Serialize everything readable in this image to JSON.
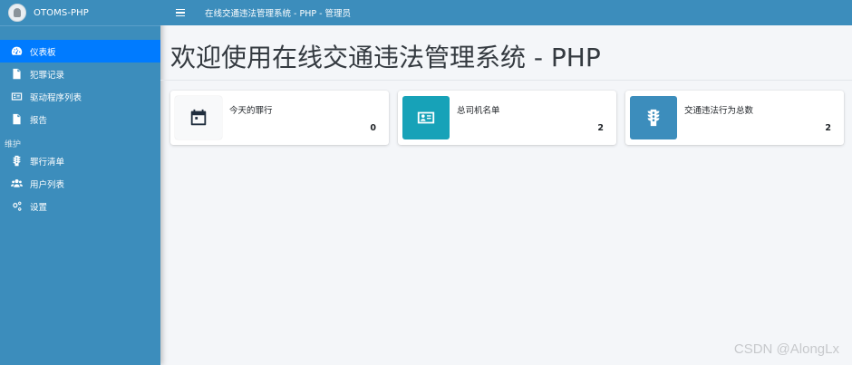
{
  "brand": {
    "name": "OTOMS-PHP"
  },
  "menu": {
    "items": [
      {
        "label": "仪表板",
        "icon": "dashboard-icon",
        "active": true
      },
      {
        "label": "犯罪记录",
        "icon": "file-icon"
      },
      {
        "label": "驱动程序列表",
        "icon": "id-card-icon"
      },
      {
        "label": "报告",
        "icon": "file-icon"
      }
    ],
    "section_header": "维护",
    "maintenance_items": [
      {
        "label": "罪行清单",
        "icon": "traffic-light-icon"
      },
      {
        "label": "用户列表",
        "icon": "users-icon"
      },
      {
        "label": "设置",
        "icon": "gears-icon"
      }
    ]
  },
  "topbar": {
    "title": "在线交通违法管理系统 - PHP - 管理员"
  },
  "page": {
    "title": "欢迎使用在线交通违法管理系统 - PHP"
  },
  "stats": [
    {
      "label": "今天的罪行",
      "value": "0",
      "icon": "calendar-icon",
      "color": "#f8f9fa"
    },
    {
      "label": "总司机名单",
      "value": "2",
      "icon": "id-card-icon",
      "color": "#17a2b8"
    },
    {
      "label": "交通违法行为总数",
      "value": "2",
      "icon": "traffic-light-icon",
      "color": "#3c8dbc"
    }
  ],
  "watermark": "CSDN @AlongLx"
}
